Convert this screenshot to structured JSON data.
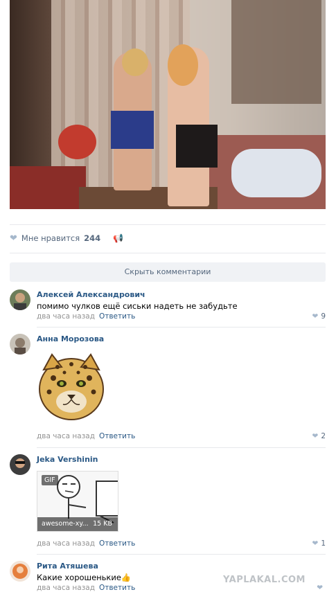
{
  "post": {
    "photo_alt": "Photo",
    "likes_label": "Мне нравится",
    "likes_count": "244"
  },
  "comments_toggle": "Скрыть комментарии",
  "comments": [
    {
      "author": "Алексей Александрович",
      "text": "помимо чулков ещё сиськи надеть не забудьте",
      "time": "два часа назад",
      "reply": "Ответить",
      "likes": "9"
    },
    {
      "author": "Анна Морозова",
      "text": "",
      "time": "два часа назад",
      "reply": "Ответить",
      "likes": "2",
      "sticker": "leopard-sticker"
    },
    {
      "author": "Jeka Vershinin",
      "text": "",
      "time": "два часа назад",
      "reply": "Ответить",
      "likes": "1",
      "gif": {
        "badge": "GIF",
        "name": "awesome-xy...",
        "size": "15 KB"
      }
    },
    {
      "author": "Рита Атяшева",
      "text": "Какие хорошенькие👍",
      "time": "два часа назад",
      "reply": "Ответить",
      "likes": ""
    }
  ],
  "watermark": "YAPLAKAL.COM",
  "colors": {
    "link": "#2a5885",
    "meta": "#939393",
    "accent_icon": "#a6b8cc",
    "panel": "#f0f2f5"
  }
}
